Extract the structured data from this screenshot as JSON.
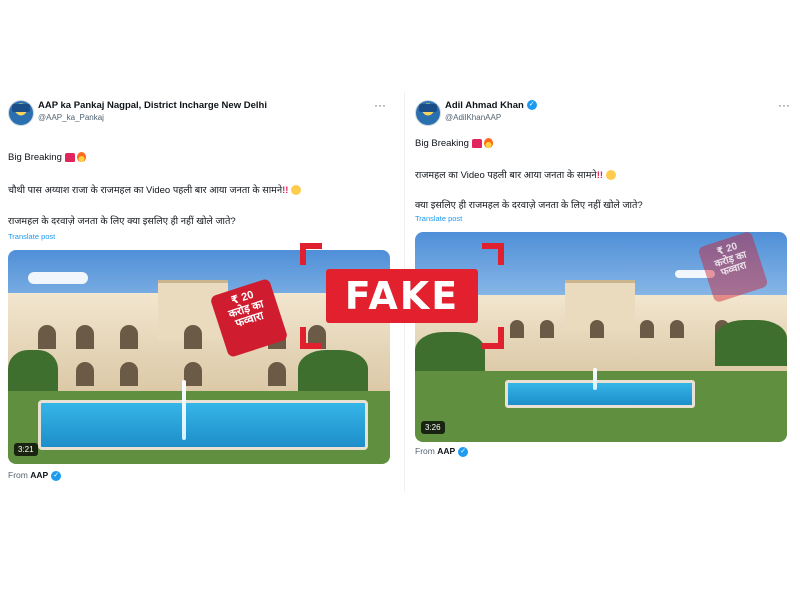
{
  "left": {
    "name": "AAP ka Pankaj Nagpal, District Incharge New Delhi",
    "handle": "@AAP_ka_Pankaj",
    "more": "···",
    "line1": "Big Breaking",
    "line2": "चौथी पास अय्याश राजा के राजमहल का Video पहली बार आया जनता के सामने",
    "line3": "राजमहल के दरवाज़े जनता के लिए क्या इसलिए ही नहीं खोले जाते?",
    "translate": "Translate post",
    "duration": "3:21",
    "tag": [
      "₹ 20",
      "करोड़ का",
      "फव्वारा"
    ],
    "from_prefix": "From",
    "from_name": "AAP"
  },
  "right": {
    "name": "Adil Ahmad Khan",
    "handle": "@AdilKhanAAP",
    "more": "···",
    "line1": "Big Breaking",
    "line2": "राजमहल का Video पहली बार आया जनता के सामने",
    "line3": "क्या इसलिए ही राजमहल के दरवाज़े जनता के लिए नहीं खोले जाते?",
    "translate": "Translate post",
    "duration": "3:26",
    "tag": [
      "₹ 20",
      "करोड़ का",
      "फव्वारा"
    ],
    "from_prefix": "From",
    "from_name": "AAP"
  },
  "stamp": {
    "text": "FAKE"
  },
  "colors": {
    "accent": "#1d9bf0",
    "stamp": "#e3202d",
    "siren": "#e0245e"
  },
  "icons": [
    "more-icon",
    "verified-icon",
    "siren-emoji-icon",
    "fire-emoji-icon",
    "blush-emoji-icon"
  ]
}
